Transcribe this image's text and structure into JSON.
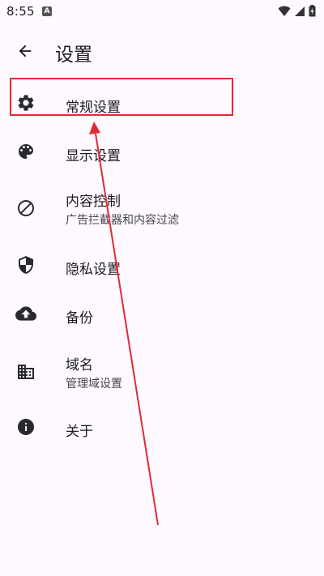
{
  "status_bar": {
    "time": "8:55",
    "app_icon": "A",
    "icons": [
      "wifi-icon",
      "signal-icon",
      "battery-charging-icon"
    ]
  },
  "app_bar": {
    "title": "设置",
    "back_icon": "arrow-back-icon"
  },
  "settings": {
    "items": [
      {
        "icon": "gear-icon",
        "title": "常规设置",
        "subtitle": ""
      },
      {
        "icon": "palette-icon",
        "title": "显示设置",
        "subtitle": ""
      },
      {
        "icon": "block-icon",
        "title": "内容控制",
        "subtitle": "广告拦截器和内容过滤"
      },
      {
        "icon": "shield-icon",
        "title": "隐私设置",
        "subtitle": ""
      },
      {
        "icon": "cloud-upload-icon",
        "title": "备份",
        "subtitle": ""
      },
      {
        "icon": "domain-icon",
        "title": "域名",
        "subtitle": "管理域设置"
      },
      {
        "icon": "info-icon",
        "title": "关于",
        "subtitle": ""
      }
    ]
  },
  "annotation": {
    "color": "#e02b35",
    "highlighted_item": "常规设置"
  },
  "colors": {
    "background": "#fdf9ff",
    "icon": "#2b2930",
    "annotation": "#e02b35"
  }
}
